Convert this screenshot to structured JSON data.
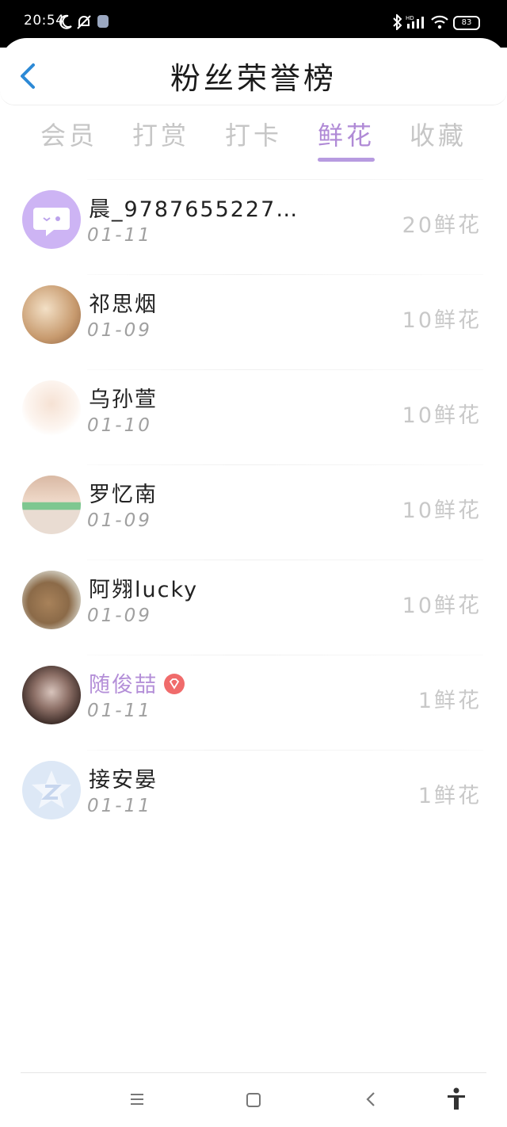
{
  "status_bar": {
    "time": "20:54",
    "battery": "83"
  },
  "header": {
    "title": "粉丝荣誉榜"
  },
  "tabs": [
    {
      "label": "会员"
    },
    {
      "label": "打赏"
    },
    {
      "label": "打卡"
    },
    {
      "label": "鲜花",
      "active": true
    },
    {
      "label": "收藏"
    }
  ],
  "fans": [
    {
      "name": "晨_9787655227…",
      "date": "01-11",
      "amount": "20鲜花"
    },
    {
      "name": "祁思烟",
      "date": "01-09",
      "amount": "10鲜花"
    },
    {
      "name": "乌孙萱",
      "date": "01-10",
      "amount": "10鲜花"
    },
    {
      "name": "罗忆南",
      "date": "01-09",
      "amount": "10鲜花"
    },
    {
      "name": "阿翙lucky",
      "date": "01-09",
      "amount": "10鲜花"
    },
    {
      "name": "随俊喆",
      "date": "01-11",
      "amount": "1鲜花",
      "vip": true
    },
    {
      "name": "接安晏",
      "date": "01-11",
      "amount": "1鲜花"
    }
  ],
  "icons": {
    "back": "chevron-left-icon",
    "nav_menu": "menu-icon",
    "nav_home": "home-square-icon",
    "nav_back": "back-chevron-icon",
    "accessibility": "accessibility-icon"
  },
  "colors": {
    "accent": "#b08ad6",
    "back_arrow": "#2d8ad6",
    "vip_badge": "#f06b6b"
  }
}
